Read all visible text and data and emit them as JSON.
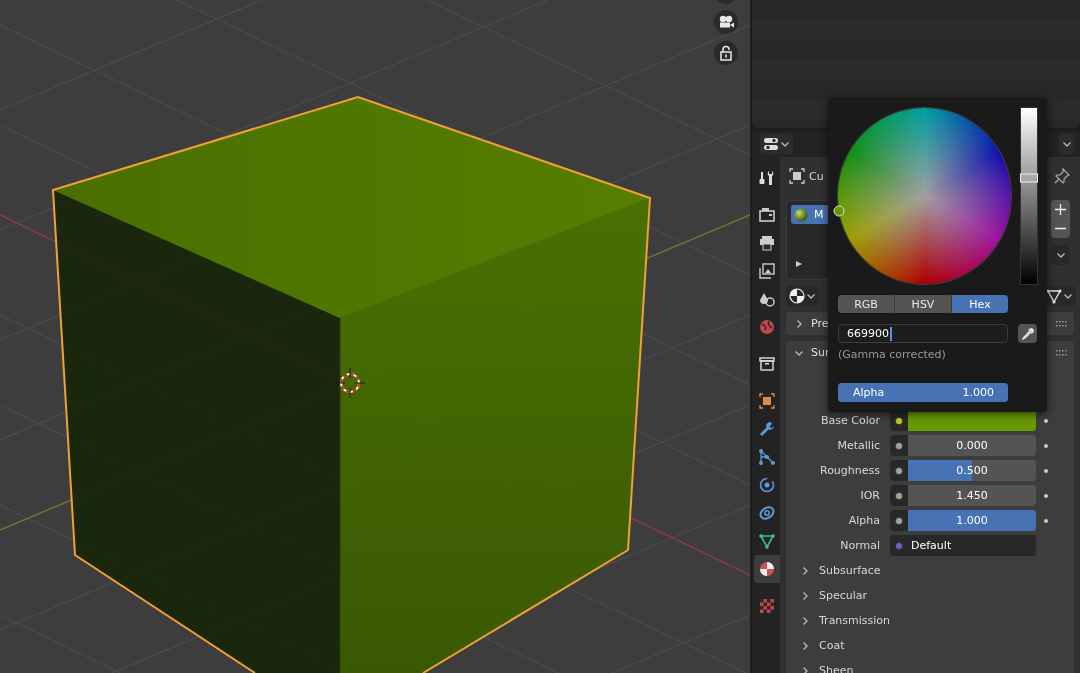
{
  "properties": {
    "tabs": [
      {
        "selected": false
      },
      {
        "selected": false
      },
      {
        "selected": false
      },
      {
        "selected": false
      },
      {
        "selected": false
      },
      {
        "selected": false
      },
      {
        "selected": false
      },
      {
        "selected": false
      },
      {
        "selected": false
      },
      {
        "selected": false
      },
      {
        "selected": false
      },
      {
        "selected": false
      },
      {
        "selected": false
      },
      {
        "selected": true
      },
      {
        "selected": false
      }
    ],
    "object_name": "Cu",
    "material_slots": [
      {
        "name": "M",
        "selected": true
      }
    ],
    "panels": [
      {
        "title": "Pre",
        "expanded": false
      },
      {
        "title": "Sur",
        "expanded": true,
        "inputs": [
          {
            "label": "Base Color",
            "kind": "color",
            "color": "#c7c729",
            "swatch": {
              "color": "#669900"
            },
            "animatable": true
          },
          {
            "label": "Metallic",
            "kind": "slider",
            "color": "#a1a1a1",
            "value": "0.000",
            "level": 0,
            "animatable": true
          },
          {
            "label": "Roughness",
            "kind": "slider",
            "color": "#a1a1a1",
            "value": "0.500",
            "level": 0.5,
            "animatable": true
          },
          {
            "label": "IOR",
            "kind": "number",
            "color": "#a1a1a1",
            "value": "1.450",
            "animatable": true
          },
          {
            "label": "Alpha",
            "kind": "slider",
            "color": "#a1a1a1",
            "value": "1.000",
            "level": 1,
            "animatable": true
          },
          {
            "label": "Normal",
            "kind": "link",
            "color": "#6363c7",
            "value": "Default",
            "animatable": false
          }
        ],
        "subpanels": [
          {
            "title": "Subsurface",
            "expanded": false
          },
          {
            "title": "Specular",
            "expanded": false
          },
          {
            "title": "Transmission",
            "expanded": false
          },
          {
            "title": "Coat",
            "expanded": false
          },
          {
            "title": "Sheen",
            "expanded": false
          }
        ]
      }
    ]
  },
  "color_picker": {
    "level": 0.6,
    "modes": [
      {
        "label": "RGB",
        "selected": false
      },
      {
        "label": "HSV",
        "selected": false
      },
      {
        "label": "Hex",
        "selected": true
      }
    ],
    "hex": "669900",
    "note": "(Gamma corrected)",
    "alpha": {
      "label": "Alpha",
      "value": "1.000",
      "level": 1
    }
  }
}
